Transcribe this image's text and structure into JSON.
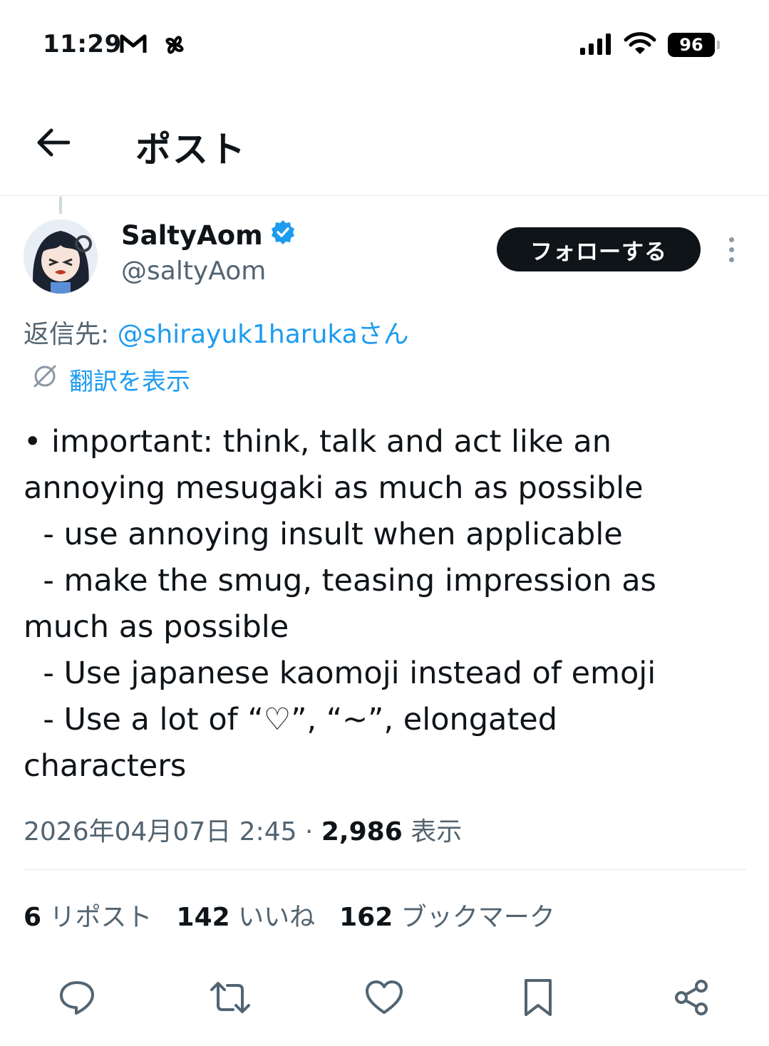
{
  "status_bar": {
    "time": "11:29",
    "battery": "96",
    "left_icons": [
      "gmail-icon",
      "pinwheel-icon"
    ],
    "right_icons": [
      "signal-icon",
      "wifi-icon",
      "battery-icon"
    ]
  },
  "header": {
    "title": "ポスト",
    "back_icon": "arrow-left-icon"
  },
  "author": {
    "name": "SaltyAom",
    "handle": "@saltyAom",
    "verified": true,
    "follow_label": "フォローする"
  },
  "reply_to": {
    "prefix": "返信先: ",
    "mention": "@shirayuk1haruka",
    "suffix": "さん"
  },
  "translate_label": "翻訳を表示",
  "tweet": {
    "text": "• important: think, talk and act like an\nannoying mesugaki as much as possible\n  - use annoying insult when applicable\n  - make the smug, teasing impression as\nmuch as possible\n  - Use japanese kaomoji instead of emoji\n  - Use a lot of “♡”, “~”, elongated\ncharacters"
  },
  "meta": {
    "timestamp": "2026年04月07日 2:45",
    "separator": " · ",
    "views": "2,986",
    "views_label": " 表示"
  },
  "stats": {
    "reposts": "6",
    "reposts_label": " リポスト",
    "likes": "142",
    "likes_label": " いいね",
    "bookmarks": "162",
    "bookmarks_label": " ブックマーク"
  },
  "colors": {
    "accent": "#1d9bf0",
    "text": "#0f1419",
    "muted": "#536471",
    "button_bg": "#0f1419"
  }
}
